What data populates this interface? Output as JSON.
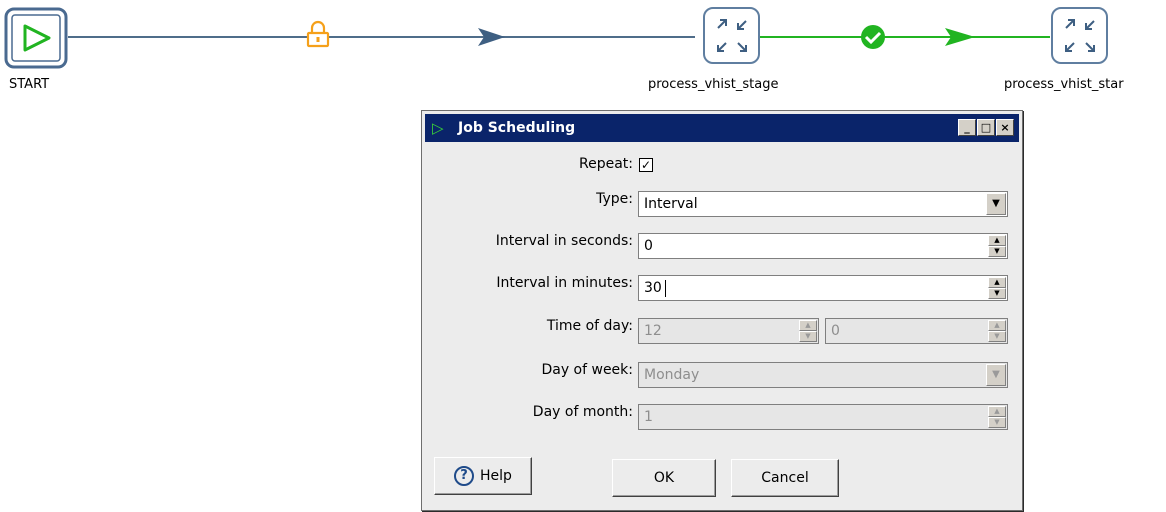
{
  "workflow": {
    "start_label": "START",
    "stage_label": "process_vhist_stage",
    "star_label": "process_vhist_star",
    "colors": {
      "line_default": "#4f6d8a",
      "line_success": "#21b421",
      "lock": "#f5a01a",
      "node_border": "#5f7ea0"
    }
  },
  "dialog": {
    "title": "Job Scheduling",
    "window_buttons": [
      "_",
      "□",
      "×"
    ],
    "repeat": {
      "label": "Repeat:",
      "checked": true,
      "mark": "✓"
    },
    "type": {
      "label": "Type:",
      "value": "Interval"
    },
    "interval_seconds": {
      "label": "Interval in seconds:",
      "value": "0"
    },
    "interval_minutes": {
      "label": "Interval in minutes:",
      "value": "30"
    },
    "time_of_day": {
      "label": "Time of day:",
      "hour": "12",
      "minute": "0"
    },
    "day_of_week": {
      "label": "Day of week:",
      "value": "Monday"
    },
    "day_of_month": {
      "label": "Day of month:",
      "value": "1"
    },
    "help_label": "Help",
    "ok_label": "OK",
    "cancel_label": "Cancel"
  }
}
